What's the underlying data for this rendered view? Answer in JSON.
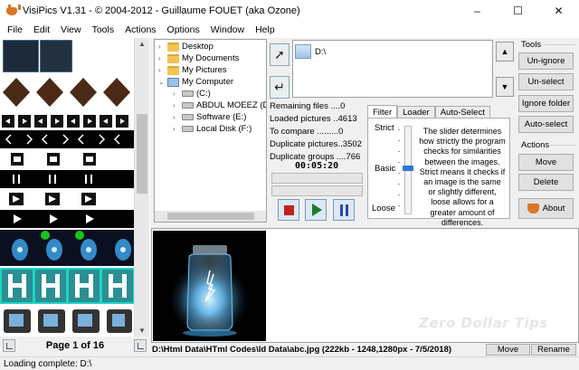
{
  "window": {
    "title": "VisiPics V1.31 - © 2004-2012 - Guillaume FOUET (aka Ozone)",
    "controls": [
      "–",
      "☐",
      "✕"
    ]
  },
  "menu": [
    "File",
    "Edit",
    "View",
    "Tools",
    "Actions",
    "Options",
    "Window",
    "Help"
  ],
  "thumbnails": {
    "page_label": "Page 1 of 16"
  },
  "tree": {
    "nodes": [
      {
        "label": "Desktop",
        "icon": "folder-icon",
        "expander": "›"
      },
      {
        "label": "My Documents",
        "icon": "folder-icon",
        "expander": "›"
      },
      {
        "label": "My Pictures",
        "icon": "folder-icon",
        "expander": "›"
      },
      {
        "label": "My Computer",
        "icon": "computer-icon",
        "expander": "⌄"
      },
      {
        "label": "(C:)",
        "icon": "drive-icon",
        "expander": "›"
      },
      {
        "label": "ABDUL MOEEZ (D:)",
        "icon": "drive-icon",
        "expander": "›"
      },
      {
        "label": "Software (E:)",
        "icon": "drive-icon",
        "expander": "›"
      },
      {
        "label": "Local Disk (F:)",
        "icon": "drive-icon",
        "expander": "›"
      }
    ]
  },
  "scan_list": {
    "path": "D:\\"
  },
  "stats": {
    "remaining": "Remaining files ....0",
    "loaded": "Loaded pictures ..4613",
    "to_compare": "To compare .........0",
    "duplicate_pictures": "Duplicate pictures..3502",
    "duplicate_groups": "Duplicate groups ....766",
    "timer": "00:05:20"
  },
  "tabs": [
    "Filter",
    "Loader",
    "Auto-Select"
  ],
  "filter": {
    "strict": "Strict",
    "basic": "Basic",
    "loose": "Loose",
    "level": 0.5,
    "description": "The slider determines how strictly the program checks for similarities between the images. Strict means it checks if an image is the same or slightly different, loose allows for a greater amount of differences."
  },
  "tools": {
    "header": "Tools",
    "unignore": "Un-ignore",
    "unselect": "Un-select",
    "ignore_folder": "Ignore folder",
    "auto_select": "Auto-select"
  },
  "actions": {
    "header": "Actions",
    "move": "Move",
    "delete": "Delete",
    "about": "About"
  },
  "preview": {
    "watermark": "Zero Dollar Tips",
    "file_info": "D:\\Html Data\\HTml Codes\\ld Data\\abc.jpg (222kb - 1248,1280px - 7/5/2018)",
    "move": "Move",
    "rename": "Rename"
  },
  "status": "Loading complete: D:\\",
  "colors": {
    "accent": "#2a78d6",
    "stop": "#c0221d",
    "play": "#1f7a2e",
    "pause": "#2b4aa8"
  }
}
